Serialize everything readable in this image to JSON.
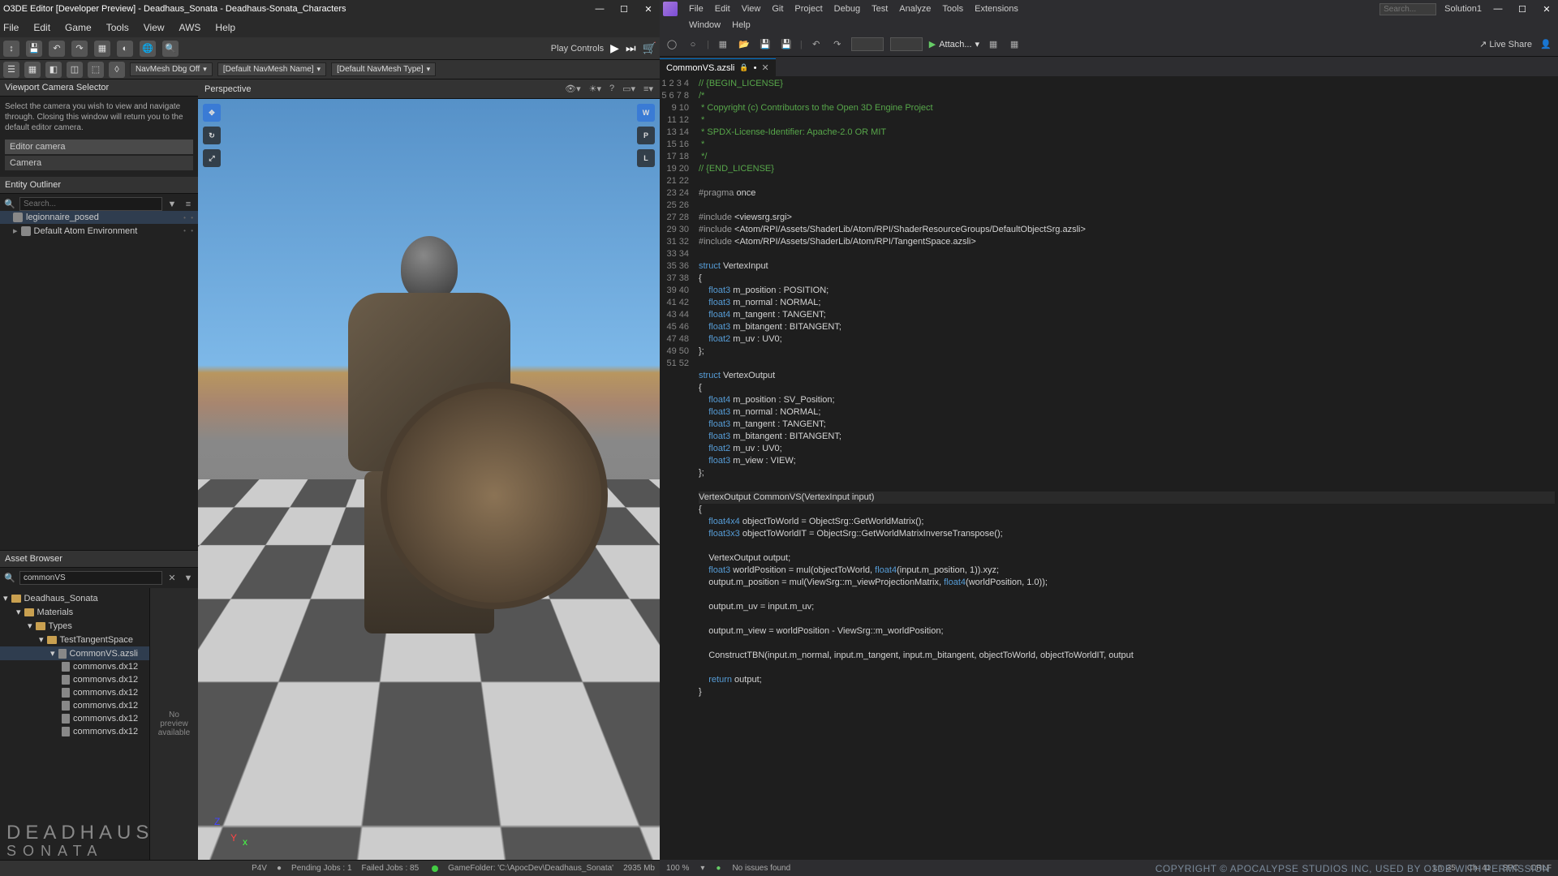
{
  "o3de": {
    "title": "O3DE Editor [Developer Preview] - Deadhaus_Sonata - Deadhaus-Sonata_Characters",
    "menu": [
      "File",
      "Edit",
      "Game",
      "Tools",
      "View",
      "AWS",
      "Help"
    ],
    "play_label": "Play Controls",
    "navmesh": {
      "dbg": "NavMesh Dbg Off",
      "name": "[Default NavMesh Name]",
      "type": "[Default NavMesh Type]"
    },
    "camera_selector": {
      "title": "Viewport Camera Selector",
      "hint": "Select the camera you wish to view and navigate through.  Closing this window will return you to the default editor camera.",
      "items": [
        "Editor camera",
        "Camera"
      ]
    },
    "outliner": {
      "title": "Entity Outliner",
      "search_placeholder": "Search...",
      "items": [
        {
          "name": "legionnaire_posed",
          "selected": true
        },
        {
          "name": "Default Atom Environment",
          "selected": false
        }
      ]
    },
    "asset_browser": {
      "title": "Asset Browser",
      "search_value": "commonVS",
      "tree": {
        "root": "Deadhaus_Sonata",
        "l1": "Materials",
        "l2": "Types",
        "l3": "TestTangentSpace",
        "l4": "CommonVS.azsli",
        "files": [
          "commonvs.dx12",
          "commonvs.dx12",
          "commonvs.dx12",
          "commonvs.dx12",
          "commonvs.dx12",
          "commonvs.dx12"
        ]
      },
      "preview": "No preview available"
    },
    "viewport": {
      "title": "Perspective",
      "badges": [
        "W",
        "P",
        "L"
      ]
    },
    "status": {
      "p4v": "P4V",
      "jobs": "Pending Jobs : 1",
      "failed": "Failed Jobs : 85",
      "folder": "GameFolder: 'C:\\ApocDev\\Deadhaus_Sonata'",
      "mem": "2935 Mb"
    },
    "logo": {
      "l1": "DEADHAUS",
      "l2": "SONATA"
    }
  },
  "vs": {
    "menu": [
      "File",
      "Edit",
      "View",
      "Git",
      "Project",
      "Debug",
      "Test",
      "Analyze",
      "Tools",
      "Extensions",
      "Window",
      "Help"
    ],
    "search_placeholder": "Search...",
    "solution": "Solution1",
    "attach": "Attach...",
    "live_share": "Live Share",
    "tab": "CommonVS.azsli",
    "status": {
      "zoom": "100 %",
      "issues": "No issues found",
      "ln": "Ln: 35",
      "ch": "Ch: 41",
      "spc": "SPC",
      "crlf": "CRLF"
    },
    "code_lines": [
      "// {BEGIN_LICENSE}",
      "/*",
      " * Copyright (c) Contributors to the Open 3D Engine Project",
      " *",
      " * SPDX-License-Identifier: Apache-2.0 OR MIT",
      " *",
      " */",
      "// {END_LICENSE}",
      "",
      "#pragma once",
      "",
      "#include <viewsrg.srgi>",
      "#include <Atom/RPI/Assets/ShaderLib/Atom/RPI/ShaderResourceGroups/DefaultObjectSrg.azsli>",
      "#include <Atom/RPI/Assets/ShaderLib/Atom/RPI/TangentSpace.azsli>",
      "",
      "struct VertexInput",
      "{",
      "    float3 m_position : POSITION;",
      "    float3 m_normal : NORMAL;",
      "    float4 m_tangent : TANGENT;",
      "    float3 m_bitangent : BITANGENT;",
      "    float2 m_uv : UV0;",
      "};",
      "",
      "struct VertexOutput",
      "{",
      "    float4 m_position : SV_Position;",
      "    float3 m_normal : NORMAL;",
      "    float3 m_tangent : TANGENT;",
      "    float3 m_bitangent : BITANGENT;",
      "    float2 m_uv : UV0;",
      "    float3 m_view : VIEW;",
      "};",
      "",
      "VertexOutput CommonVS(VertexInput input)",
      "{",
      "    float4x4 objectToWorld = ObjectSrg::GetWorldMatrix();",
      "    float3x3 objectToWorldIT = ObjectSrg::GetWorldMatrixInverseTranspose();",
      "",
      "    VertexOutput output;",
      "    float3 worldPosition = mul(objectToWorld, float4(input.m_position, 1)).xyz;",
      "    output.m_position = mul(ViewSrg::m_viewProjectionMatrix, float4(worldPosition, 1.0));",
      "",
      "    output.m_uv = input.m_uv;",
      "",
      "    output.m_view = worldPosition - ViewSrg::m_worldPosition;",
      "",
      "    ConstructTBN(input.m_normal, input.m_tangent, input.m_bitangent, objectToWorld, objectToWorldIT, output",
      "",
      "    return output;",
      "}",
      ""
    ]
  },
  "copyright": "COPYRIGHT © APOCALYPSE STUDIOS INC, USED BY O3DE WITH PERMISSION"
}
